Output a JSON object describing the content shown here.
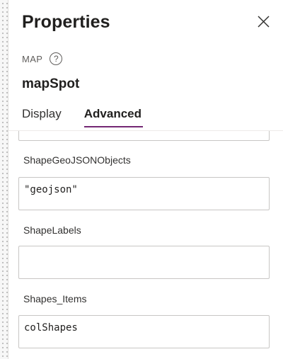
{
  "panel": {
    "title": "Properties",
    "close_icon": "close-icon",
    "control_type": "MAP",
    "help_icon": "help-icon",
    "help_glyph": "?",
    "control_name": "mapSpot"
  },
  "tabs": [
    {
      "label": "Display",
      "active": false
    },
    {
      "label": "Advanced",
      "active": true
    }
  ],
  "properties": [
    {
      "label": "ShapeGeoJSONObjects",
      "value": "\"geojson\""
    },
    {
      "label": "ShapeLabels",
      "value": ""
    },
    {
      "label": "Shapes_Items",
      "value": "colShapes"
    }
  ],
  "colors": {
    "accent": "#742774",
    "text": "#201f1e",
    "muted": "#605e5c",
    "border": "#c8c6c4"
  }
}
